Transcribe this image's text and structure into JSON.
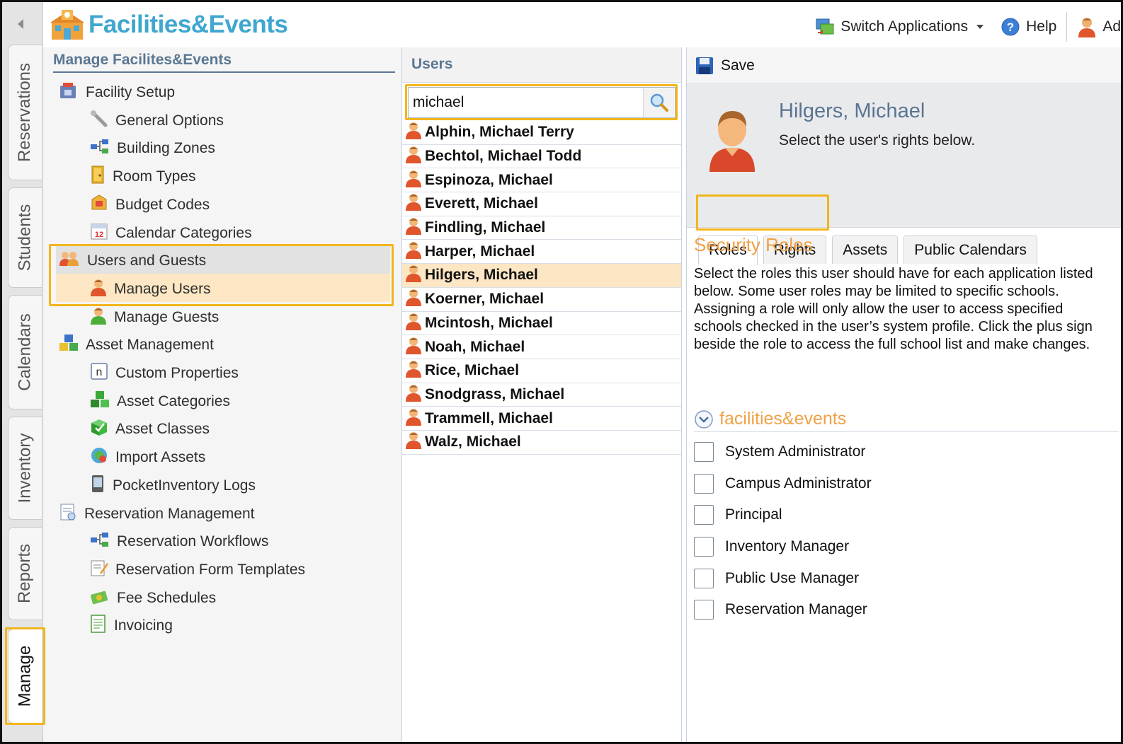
{
  "app": {
    "logo_text": "Facilities&Events",
    "switch_apps_label": "Switch Applications",
    "help_label": "Help",
    "account_label": "Ad"
  },
  "vertical_tabs": [
    "Reservations",
    "Students",
    "Calendars",
    "Inventory",
    "Reports",
    "Manage"
  ],
  "nav": {
    "title": "Manage Facilites&Events",
    "items": [
      {
        "label": "Facility Setup",
        "icon": "facility-icon"
      },
      {
        "label": "General Options",
        "icon": "wrench-icon"
      },
      {
        "label": "Building Zones",
        "icon": "zones-icon"
      },
      {
        "label": "Room Types",
        "icon": "door-icon"
      },
      {
        "label": "Budget Codes",
        "icon": "budget-icon"
      },
      {
        "label": "Calendar Categories",
        "icon": "calendar-icon"
      },
      {
        "label": "Users and Guests",
        "icon": "users-icon"
      },
      {
        "label": "Manage Users",
        "icon": "user-icon"
      },
      {
        "label": "Manage Guests",
        "icon": "guest-icon"
      },
      {
        "label": "Asset Management",
        "icon": "boxes-icon"
      },
      {
        "label": "Custom Properties",
        "icon": "custom-property-icon"
      },
      {
        "label": "Asset Categories",
        "icon": "asset-category-icon"
      },
      {
        "label": "Asset Classes",
        "icon": "asset-class-icon"
      },
      {
        "label": "Import Assets",
        "icon": "import-icon"
      },
      {
        "label": "PocketInventory Logs",
        "icon": "device-icon"
      },
      {
        "label": "Reservation Management",
        "icon": "reservation-icon"
      },
      {
        "label": "Reservation Workflows",
        "icon": "workflow-icon"
      },
      {
        "label": "Reservation Form Templates",
        "icon": "form-template-icon"
      },
      {
        "label": "Fee Schedules",
        "icon": "fee-icon"
      },
      {
        "label": "Invoicing",
        "icon": "invoice-icon"
      }
    ]
  },
  "users_panel": {
    "title": "Users",
    "search_value": "michael",
    "users": [
      "Alphin, Michael Terry",
      "Bechtol, Michael Todd",
      "Espinoza, Michael",
      "Everett, Michael",
      "Findling, Michael",
      "Harper, Michael",
      "Hilgers, Michael",
      "Koerner, Michael",
      "Mcintosh, Michael",
      "Noah, Michael",
      "Rice, Michael",
      "Snodgrass, Michael",
      "Trammell, Michael",
      "Walz, Michael"
    ],
    "selected": "Hilgers, Michael"
  },
  "detail": {
    "save_label": "Save",
    "user_name": "Hilgers, Michael",
    "subtitle": "Select the user's rights below.",
    "tabs": [
      "Roles",
      "Rights",
      "Assets",
      "Public Calendars"
    ],
    "active_tab": "Roles",
    "section_title": "Security Roles",
    "section_desc": "Select the roles this user should have for each application listed below. Some user roles may be limited to specific schools. Assigning a role will only allow the user to access specified schools checked in the user’s system profile. Click the plus sign beside the role to access the full school list and make changes.",
    "group_title": "facilities&events",
    "roles": [
      "System Administrator",
      "Campus Administrator",
      "Principal",
      "Inventory Manager",
      "Public Use Manager",
      "Reservation Manager"
    ]
  },
  "colors": {
    "highlight": "#f2b51c",
    "logo": "#3fa7cf",
    "section_orange": "#f0a146",
    "header_blue": "#5b7793",
    "selected_row": "#fce6c4"
  }
}
